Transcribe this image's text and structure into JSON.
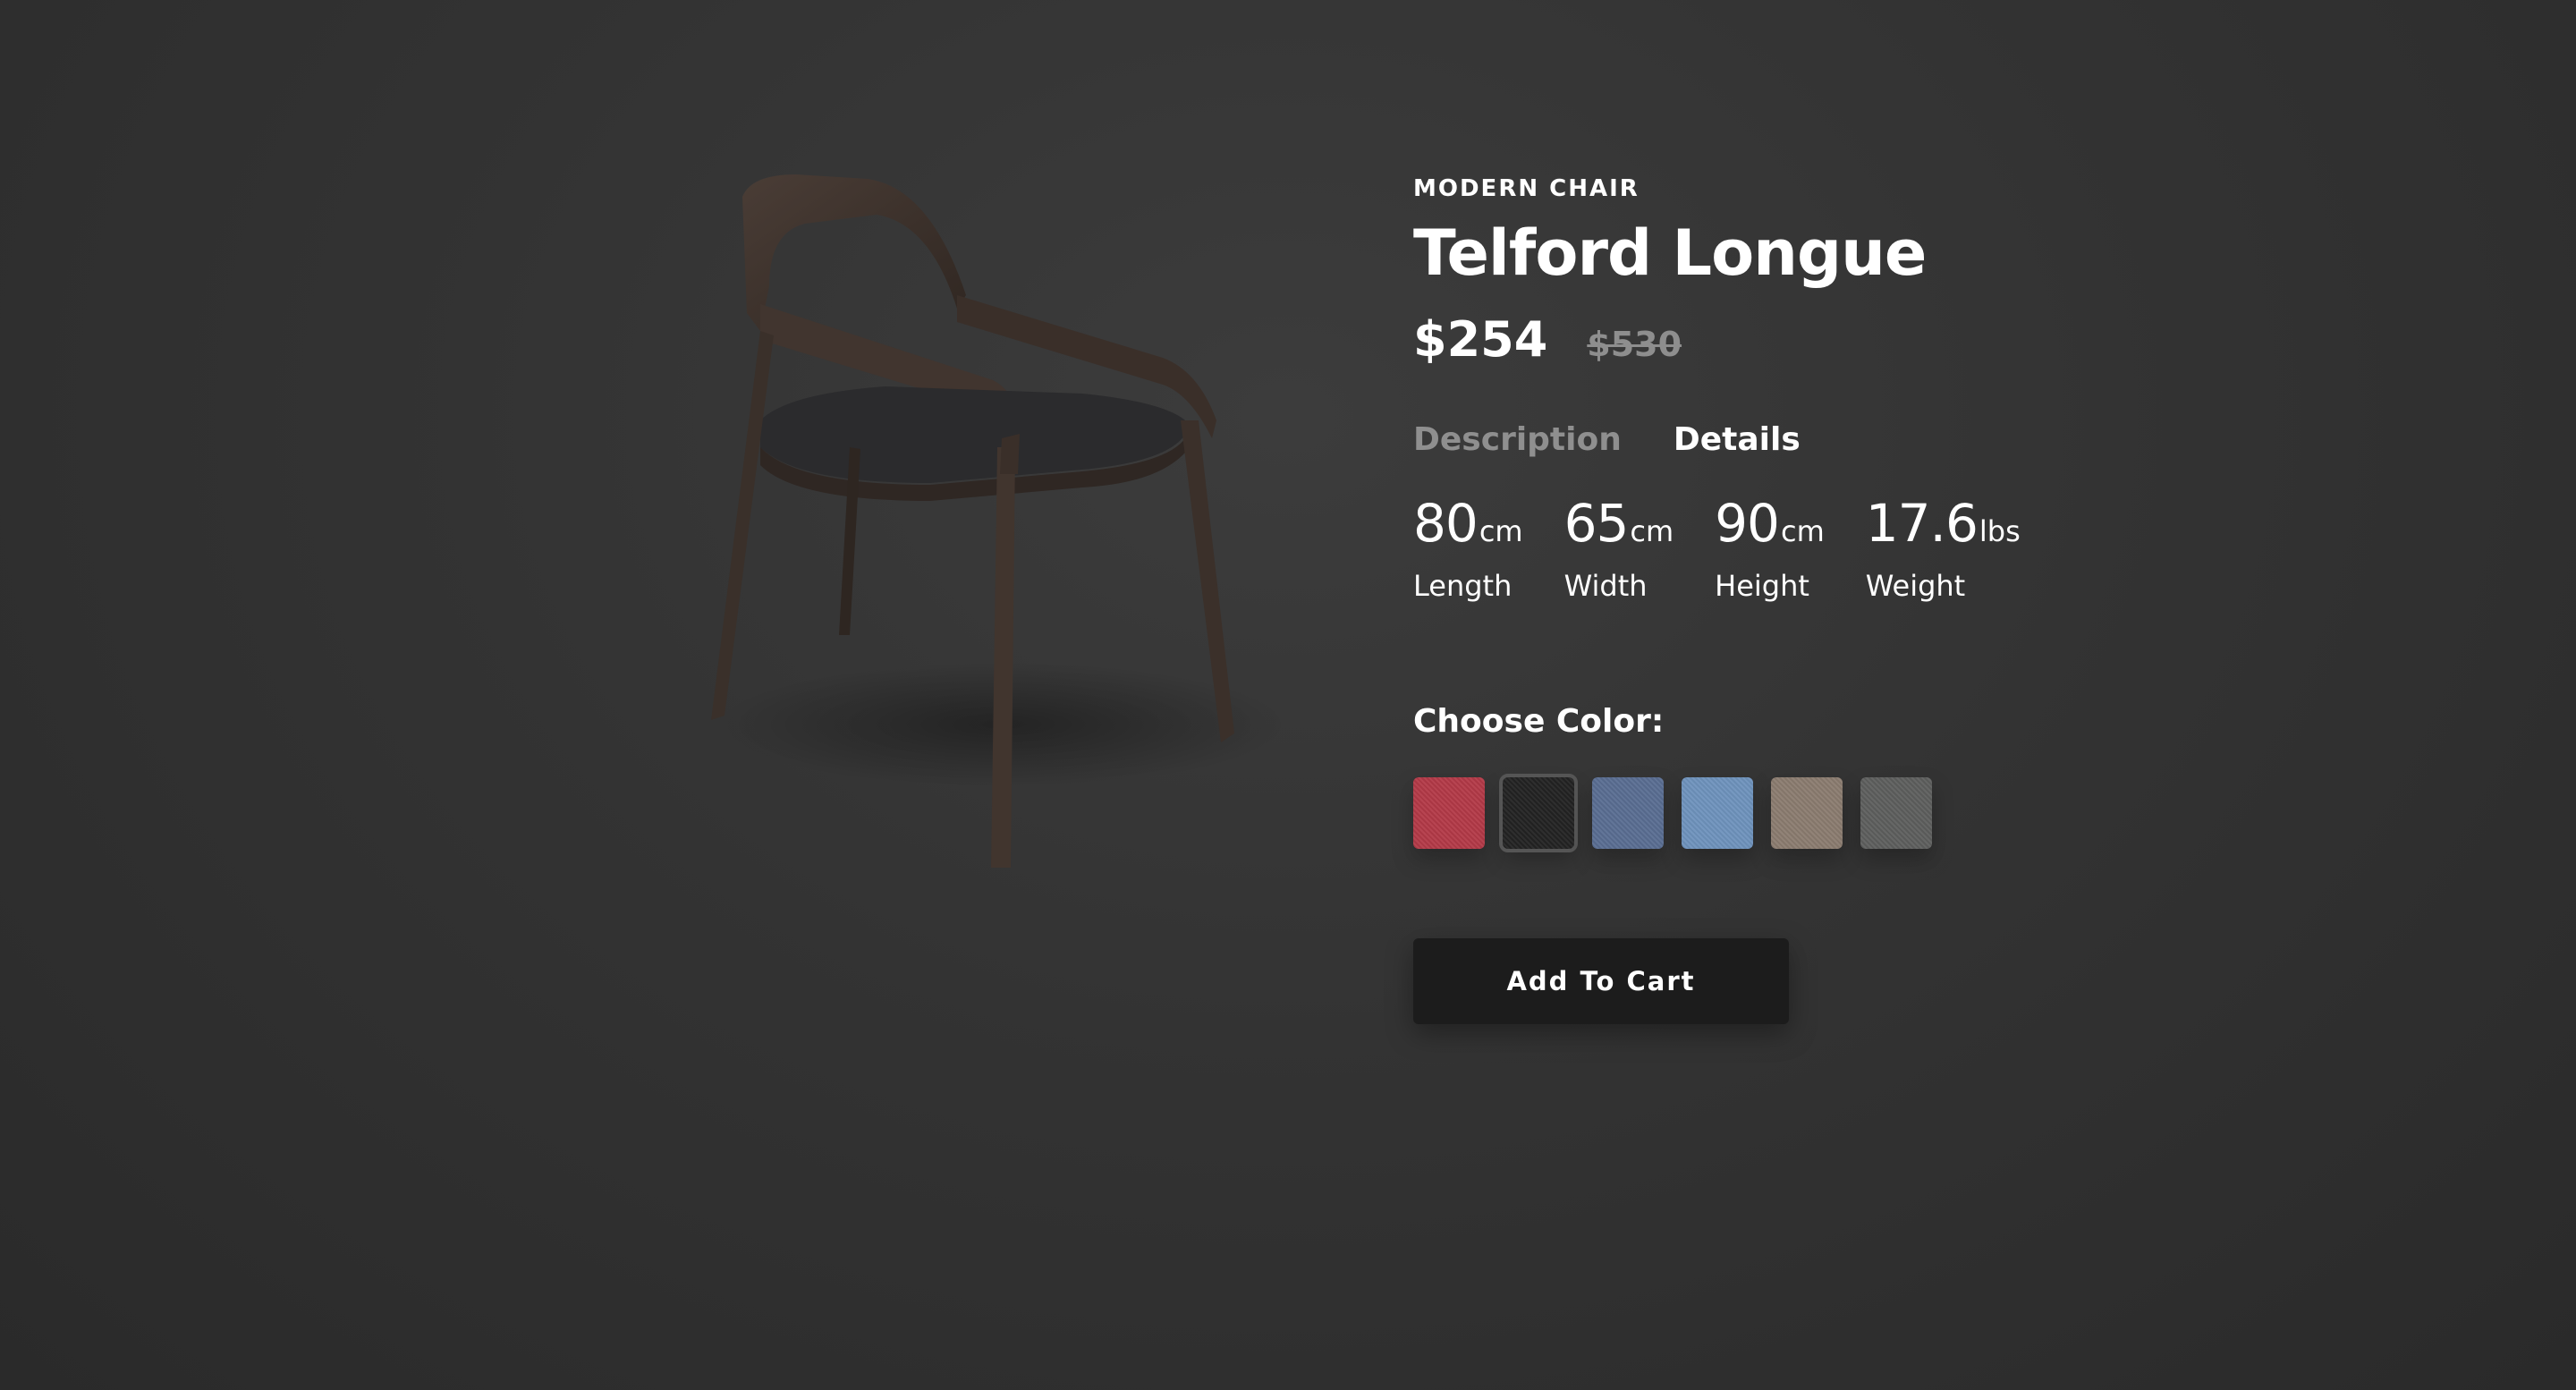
{
  "product": {
    "category": "MODERN CHAIR",
    "name": "Telford Longue",
    "price": "$254",
    "old_price": "$530",
    "image_alt_icon": "chair-image"
  },
  "tabs": [
    {
      "label": "Description",
      "active": false
    },
    {
      "label": "Details",
      "active": true
    }
  ],
  "specs": [
    {
      "value": "80",
      "unit": "cm",
      "label": "Length"
    },
    {
      "value": "65",
      "unit": "cm",
      "label": "Width"
    },
    {
      "value": "90",
      "unit": "cm",
      "label": "Height"
    },
    {
      "value": "17.6",
      "unit": "lbs",
      "label": "Weight"
    }
  ],
  "color_section": {
    "label": "Choose Color:",
    "swatches": [
      {
        "name": "red",
        "color": "#b33a48",
        "selected": false
      },
      {
        "name": "black",
        "color": "#232323",
        "selected": true
      },
      {
        "name": "denim",
        "color": "#5a6e92",
        "selected": false
      },
      {
        "name": "light-blue",
        "color": "#6f93bd",
        "selected": false
      },
      {
        "name": "beige",
        "color": "#8b7c70",
        "selected": false
      },
      {
        "name": "gray",
        "color": "#5e5f5e",
        "selected": false
      }
    ]
  },
  "cart_button": {
    "label": "Add To Cart"
  },
  "colors": {
    "background": "#333333",
    "text": "#ffffff",
    "muted": "#8f8f8f",
    "button": "#1c1c1c"
  }
}
